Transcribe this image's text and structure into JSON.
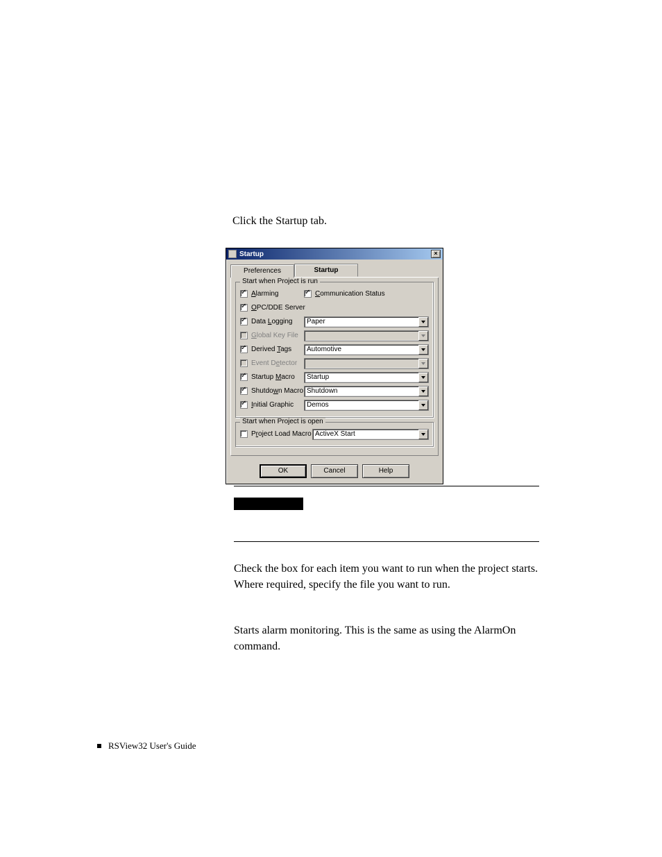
{
  "page": {
    "instruction": "Click the Startup tab.",
    "para1": "Check the box for each item you want to run when the project starts. Where required, specify the file you want to run.",
    "para2": "Starts alarm monitoring. This is the same as using the AlarmOn command.",
    "footer": "RSView32  User's Guide"
  },
  "dialog": {
    "title": "Startup",
    "close_x": "×",
    "tabs": {
      "preferences": "Preferences",
      "startup": "Startup"
    },
    "group_run": "Start when Project is run",
    "group_open": "Start when Project is open",
    "fields": {
      "alarming": {
        "label_pre": "",
        "label_u": "A",
        "label_post": "larming",
        "checked": true,
        "disabled": false
      },
      "comm": {
        "label_u": "C",
        "label_post": "ommunication Status",
        "checked": true,
        "disabled": false
      },
      "opc": {
        "label_u": "O",
        "label_post": "PC/DDE Server",
        "checked": true,
        "disabled": false
      },
      "datalog": {
        "label_pre": "Data ",
        "label_u": "L",
        "label_post": "ogging",
        "checked": true,
        "disabled": false,
        "value": "Paper"
      },
      "global": {
        "label_u": "G",
        "label_post": "lobal Key File",
        "checked": false,
        "disabled": true,
        "value": ""
      },
      "derived": {
        "label_pre": "Derived ",
        "label_u": "T",
        "label_post": "ags",
        "checked": true,
        "disabled": false,
        "value": "Automotive"
      },
      "event": {
        "label_pre": "Event D",
        "label_u": "e",
        "label_post": "tector",
        "checked": false,
        "disabled": true,
        "value": ""
      },
      "startupmacro": {
        "label_pre": "Startup ",
        "label_u": "M",
        "label_post": "acro",
        "checked": true,
        "disabled": false,
        "value": "Startup"
      },
      "shutdownmacro": {
        "label_pre": "Shutdo",
        "label_u": "w",
        "label_post": "n Macro",
        "checked": true,
        "disabled": false,
        "value": "Shutdown"
      },
      "initial": {
        "label_u": "I",
        "label_post": "nitial Graphic",
        "checked": true,
        "disabled": false,
        "value": "Demos"
      },
      "projectload": {
        "label_pre": "P",
        "label_u": "r",
        "label_post": "oject Load Macro",
        "checked": false,
        "disabled": false,
        "value": "ActiveX Start"
      }
    },
    "buttons": {
      "ok": "OK",
      "cancel": "Cancel",
      "help": "Help"
    }
  }
}
